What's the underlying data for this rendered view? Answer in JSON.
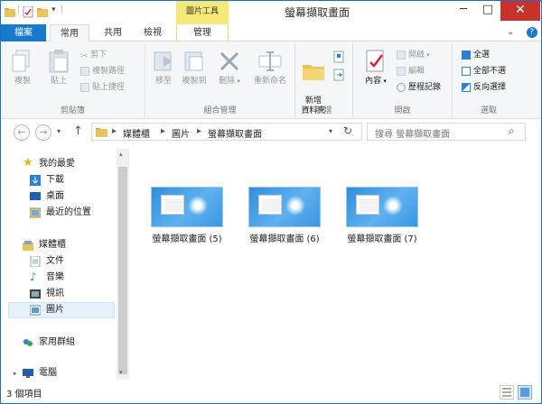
{
  "window": {
    "title": "螢幕擷取畫面",
    "context_tab_group": "圖片工具",
    "minimize": "─",
    "maximize": "□",
    "close": "✕"
  },
  "tabs": {
    "file": "檔案",
    "home": "常用",
    "share": "共用",
    "view": "檢視",
    "manage": "管理"
  },
  "ribbon": {
    "clipboard": {
      "label": "剪貼簿",
      "copy": "複製",
      "paste": "貼上",
      "cut": "剪下",
      "copy_path": "複製路徑",
      "paste_shortcut": "貼上捷徑"
    },
    "organize": {
      "label": "組合管理",
      "move_to": "移至",
      "copy_to": "複製到",
      "delete": "刪除",
      "rename": "重新命名"
    },
    "new": {
      "label": "新增",
      "new_folder": "新增\n資料夾"
    },
    "open": {
      "label": "開啟",
      "properties": "內容",
      "open": "開啟",
      "edit": "編輯",
      "history": "歷程記錄"
    },
    "select": {
      "label": "選取",
      "select_all": "全選",
      "select_none": "全部不選",
      "invert": "反向選擇"
    }
  },
  "address": {
    "crumbs": [
      "媒體櫃",
      "圖片",
      "螢幕擷取畫面"
    ],
    "search_placeholder": "搜尋 螢幕擷取畫面"
  },
  "nav": {
    "favorites": "我的最愛",
    "downloads": "下載",
    "desktop": "桌面",
    "recent": "最近的位置",
    "libraries": "媒體櫃",
    "documents": "文件",
    "music": "音樂",
    "videos": "視訊",
    "pictures": "圖片",
    "homegroup": "家用群組",
    "computer": "電腦"
  },
  "files": [
    {
      "name": "螢幕擷取畫面 (5)"
    },
    {
      "name": "螢幕擷取畫面 (6)"
    },
    {
      "name": "螢幕擷取畫面 (7)"
    }
  ],
  "status": {
    "count": "3 個項目"
  },
  "colors": {
    "file_tab": "#1979ca",
    "context_tab": "#f6e97a",
    "close_button": "#c7322b",
    "selection": "#e5f1fb"
  }
}
